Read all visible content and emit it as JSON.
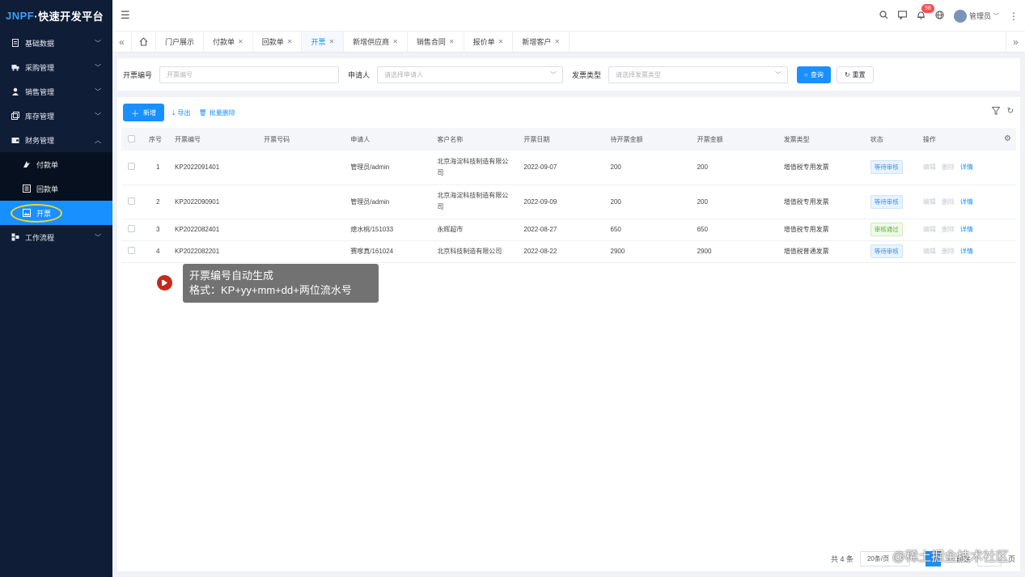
{
  "app": {
    "logo_main": "JNPF",
    "logo_sub": "·快速开发平台"
  },
  "sidebar": {
    "items": [
      {
        "label": "基础数据",
        "icon": "document-icon"
      },
      {
        "label": "采购管理",
        "icon": "truck-icon"
      },
      {
        "label": "销售管理",
        "icon": "user-icon"
      },
      {
        "label": "库存管理",
        "icon": "copy-icon"
      },
      {
        "label": "财务管理",
        "icon": "wallet-icon"
      },
      {
        "label": "工作流程",
        "icon": "flow-icon"
      }
    ],
    "sub_items": [
      {
        "label": "付款单",
        "icon": "pay-icon"
      },
      {
        "label": "回款单",
        "icon": "receipt-icon"
      },
      {
        "label": "开票",
        "icon": "image-icon"
      }
    ]
  },
  "header": {
    "badge_count": "58",
    "user_name": "管理员"
  },
  "tabs": [
    {
      "label": "门户展示"
    },
    {
      "label": "付款单"
    },
    {
      "label": "回款单"
    },
    {
      "label": "开票"
    },
    {
      "label": "新增供应商"
    },
    {
      "label": "销售合同"
    },
    {
      "label": "报价单"
    },
    {
      "label": "新增客户"
    }
  ],
  "search": {
    "invoice_no_label": "开票编号",
    "invoice_no_placeholder": "开票编号",
    "applicant_label": "申请人",
    "applicant_placeholder": "请选择申请人",
    "invoice_type_label": "发票类型",
    "invoice_type_placeholder": "请选择发票类型",
    "query_button": "查询",
    "reset_button": "重置"
  },
  "toolbar": {
    "add_button": "新增",
    "export_button": "导出",
    "batch_delete_button": "批量删除"
  },
  "table": {
    "headers": [
      "序号",
      "开票编号",
      "开票号码",
      "申请人",
      "客户名称",
      "开票日期",
      "待开票金额",
      "开票金额",
      "发票类型",
      "状态",
      "操作"
    ],
    "rows": [
      {
        "index": "1",
        "invoice_no": "KP2022091401",
        "invoice_code": "",
        "applicant": "管理员/admin",
        "customer": "北京海淀科技制造有限公司",
        "date": "2022-09-07",
        "pending_amount": "200",
        "amount": "200",
        "type": "增值税专用发票",
        "status": "等待审核",
        "status_kind": "wait"
      },
      {
        "index": "2",
        "invoice_no": "KP2022090901",
        "invoice_code": "",
        "applicant": "管理员/admin",
        "customer": "北京海淀科技制造有限公司",
        "date": "2022-09-09",
        "pending_amount": "200",
        "amount": "200",
        "type": "增值税专用发票",
        "status": "等待审核",
        "status_kind": "wait"
      },
      {
        "index": "3",
        "invoice_no": "KP2022082401",
        "invoice_code": "",
        "applicant": "熄水桃/151033",
        "customer": "永辉超市",
        "date": "2022-08-27",
        "pending_amount": "650",
        "amount": "650",
        "type": "增值税专用发票",
        "status": "审核通过",
        "status_kind": "pass"
      },
      {
        "index": "4",
        "invoice_no": "KP2022082201",
        "invoice_code": "",
        "applicant": "赛嗲真/161024",
        "customer": "北京科技制造有限公司",
        "date": "2022-08-22",
        "pending_amount": "2900",
        "amount": "2900",
        "type": "增值税普通发票",
        "status": "等待审核",
        "status_kind": "wait"
      }
    ],
    "ops": {
      "edit": "编辑",
      "delete": "删除",
      "detail": "详情"
    }
  },
  "tooltip": {
    "line1": "开票编号自动生成",
    "line2": "格式：KP+yy+mm+dd+两位流水号"
  },
  "pager": {
    "total": "共 4 条",
    "page_size": "20条/页",
    "current": "1",
    "goto_prefix": "前往",
    "goto_suffix": "页"
  },
  "watermark": "@稀土掘金技术社区",
  "colors": {
    "primary": "#1890ff",
    "sidebar_bg": "#0f1d36",
    "highlight_ring": "#f5d22a",
    "play_button": "#c7281c"
  }
}
